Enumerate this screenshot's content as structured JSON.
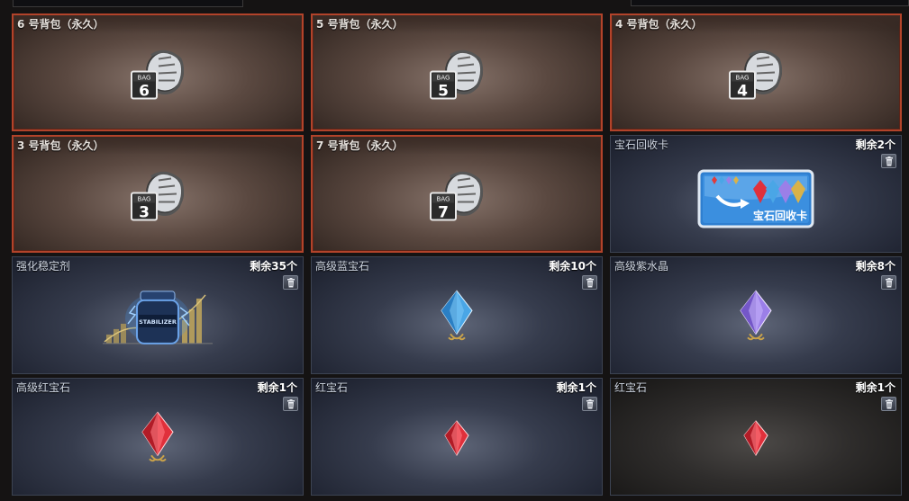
{
  "items": [
    {
      "name": "6 号背包（永久）",
      "count": "",
      "bag_number": "6",
      "bag_label": "BAG",
      "kind": "bag",
      "icon": "backpack-icon"
    },
    {
      "name": "5 号背包（永久）",
      "count": "",
      "bag_number": "5",
      "bag_label": "BAG",
      "kind": "bag",
      "icon": "backpack-icon"
    },
    {
      "name": "4 号背包（永久）",
      "count": "",
      "bag_number": "4",
      "bag_label": "BAG",
      "kind": "bag",
      "icon": "backpack-icon"
    },
    {
      "name": "3 号背包（永久）",
      "count": "",
      "bag_number": "3",
      "bag_label": "BAG",
      "kind": "bag",
      "icon": "backpack-icon"
    },
    {
      "name": "7 号背包（永久）",
      "count": "",
      "bag_number": "7",
      "bag_label": "BAG",
      "kind": "bag",
      "icon": "backpack-icon"
    },
    {
      "name": "宝石回收卡",
      "count": "剩余2个",
      "kind": "card",
      "card_text": "宝石回收卡",
      "icon": "gem-recycle-card-icon"
    },
    {
      "name": "强化稳定剂",
      "count": "剩余35个",
      "kind": "stabilizer",
      "jar_text": "STABILIZER",
      "icon": "stabilizer-jar-icon"
    },
    {
      "name": "高级蓝宝石",
      "count": "剩余10个",
      "kind": "gem",
      "gem_color": "#4aa6e6",
      "icon": "blue-sapphire-icon"
    },
    {
      "name": "高级紫水晶",
      "count": "剩余8个",
      "kind": "gem",
      "gem_color": "#9b7fe8",
      "icon": "purple-amethyst-icon"
    },
    {
      "name": "高级红宝石",
      "count": "剩余1个",
      "kind": "gem",
      "gem_color": "#e0303b",
      "icon": "red-ruby-icon"
    },
    {
      "name": "红宝石",
      "count": "剩余1个",
      "kind": "gem-small",
      "gem_color": "#e0303b",
      "icon": "red-ruby-icon"
    },
    {
      "name": "红宝石",
      "count": "剩余1个",
      "kind": "gem-small",
      "gem_color": "#e0303b",
      "icon": "red-ruby-icon"
    }
  ],
  "colors": {
    "bag_border": "#b2432a",
    "card_blue": "#2f7fd0"
  }
}
